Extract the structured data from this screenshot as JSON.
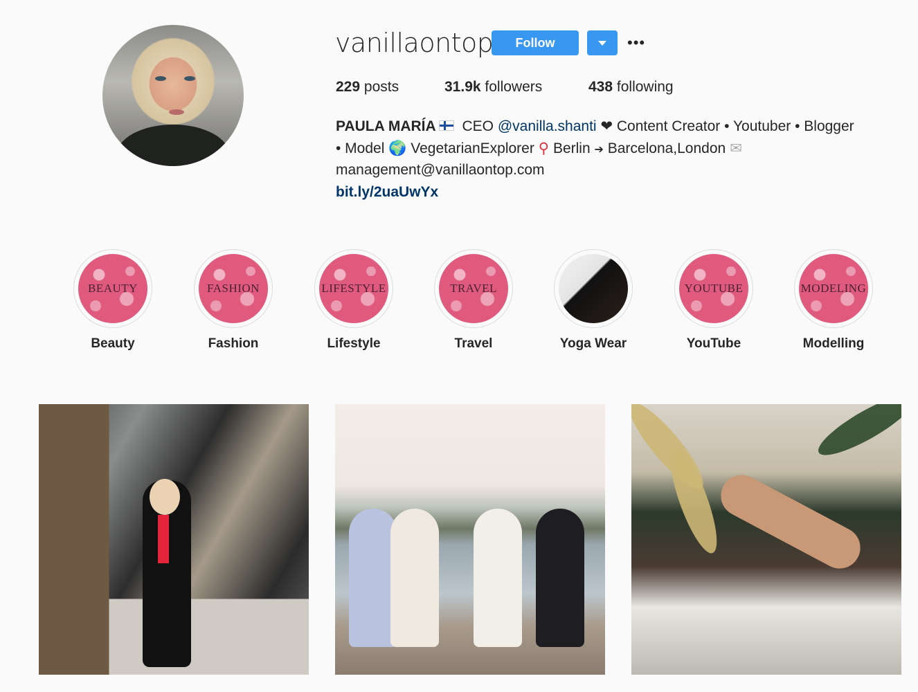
{
  "profile": {
    "username": "vanillaontop",
    "follow_label": "Follow",
    "more_label": "•••",
    "stats": [
      {
        "count": "229",
        "label": "posts"
      },
      {
        "count": "31.9k",
        "label": "followers"
      },
      {
        "count": "438",
        "label": "following"
      }
    ],
    "bio": {
      "name": "PAULA MARÍA",
      "ceo": "CEO",
      "mention": "@vanilla.shanti",
      "line1_rest": "Content Creator • Youtuber • Blogger",
      "line2_a": "• Model",
      "line2_b": "VegetarianExplorer",
      "line2_c": "Berlin",
      "line2_d": "Barcelona,London",
      "email": "management@vanillaontop.com",
      "link": "bit.ly/2uaUwYx"
    }
  },
  "highlights": [
    {
      "cover": "BEAUTY",
      "label": "Beauty"
    },
    {
      "cover": "FASHION",
      "label": "Fashion"
    },
    {
      "cover": "LIFESTYLE",
      "label": "Lifestyle"
    },
    {
      "cover": "TRAVEL",
      "label": "Travel"
    },
    {
      "cover": "",
      "label": "Yoga Wear"
    },
    {
      "cover": "YOUTUBE",
      "label": "YouTube"
    },
    {
      "cover": "MODELING",
      "label": "Modelling"
    }
  ],
  "icons": {
    "follow_dropdown": "chevron-down-icon",
    "more": "more-options-icon",
    "flag": "finland-flag-icon",
    "heart": "black-heart-icon",
    "globe": "globe-icon",
    "pin": "map-pin-icon",
    "soon": "soon-arrow-icon",
    "mail": "envelope-icon"
  },
  "colors": {
    "accent": "#3897f0",
    "link": "#003569",
    "highlight_cover": "#e05a7e"
  }
}
